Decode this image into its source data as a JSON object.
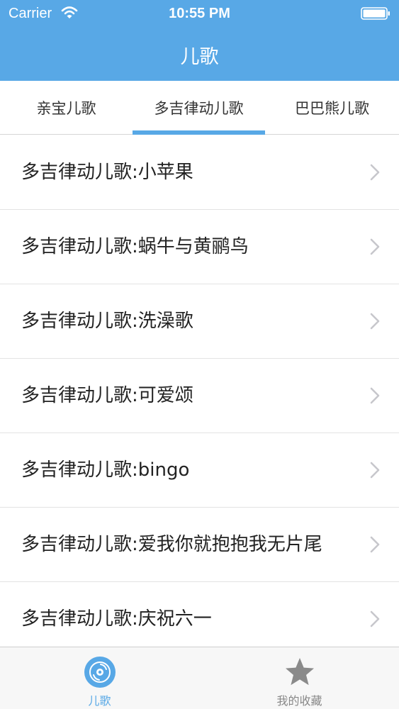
{
  "status_bar": {
    "carrier": "Carrier",
    "time": "10:55 PM"
  },
  "nav": {
    "title": "儿歌"
  },
  "tabs": [
    {
      "label": "亲宝儿歌",
      "selected": false
    },
    {
      "label": "多吉律动儿歌",
      "selected": true
    },
    {
      "label": "巴巴熊儿歌",
      "selected": false
    }
  ],
  "list": [
    {
      "label": "多吉律动儿歌:小苹果"
    },
    {
      "label": "多吉律动儿歌:蜗牛与黄鹂鸟"
    },
    {
      "label": "多吉律动儿歌:洗澡歌"
    },
    {
      "label": "多吉律动儿歌:可爱颂"
    },
    {
      "label": "多吉律动儿歌:bingo"
    },
    {
      "label": "多吉律动儿歌:爱我你就抱抱我无片尾"
    },
    {
      "label": "多吉律动儿歌:庆祝六一"
    }
  ],
  "tabbar": {
    "items": [
      {
        "label": "儿歌",
        "icon": "disc-icon",
        "selected": true
      },
      {
        "label": "我的收藏",
        "icon": "star-icon",
        "selected": false
      }
    ]
  },
  "colors": {
    "accent": "#58a8e6",
    "inactive": "#888888"
  }
}
